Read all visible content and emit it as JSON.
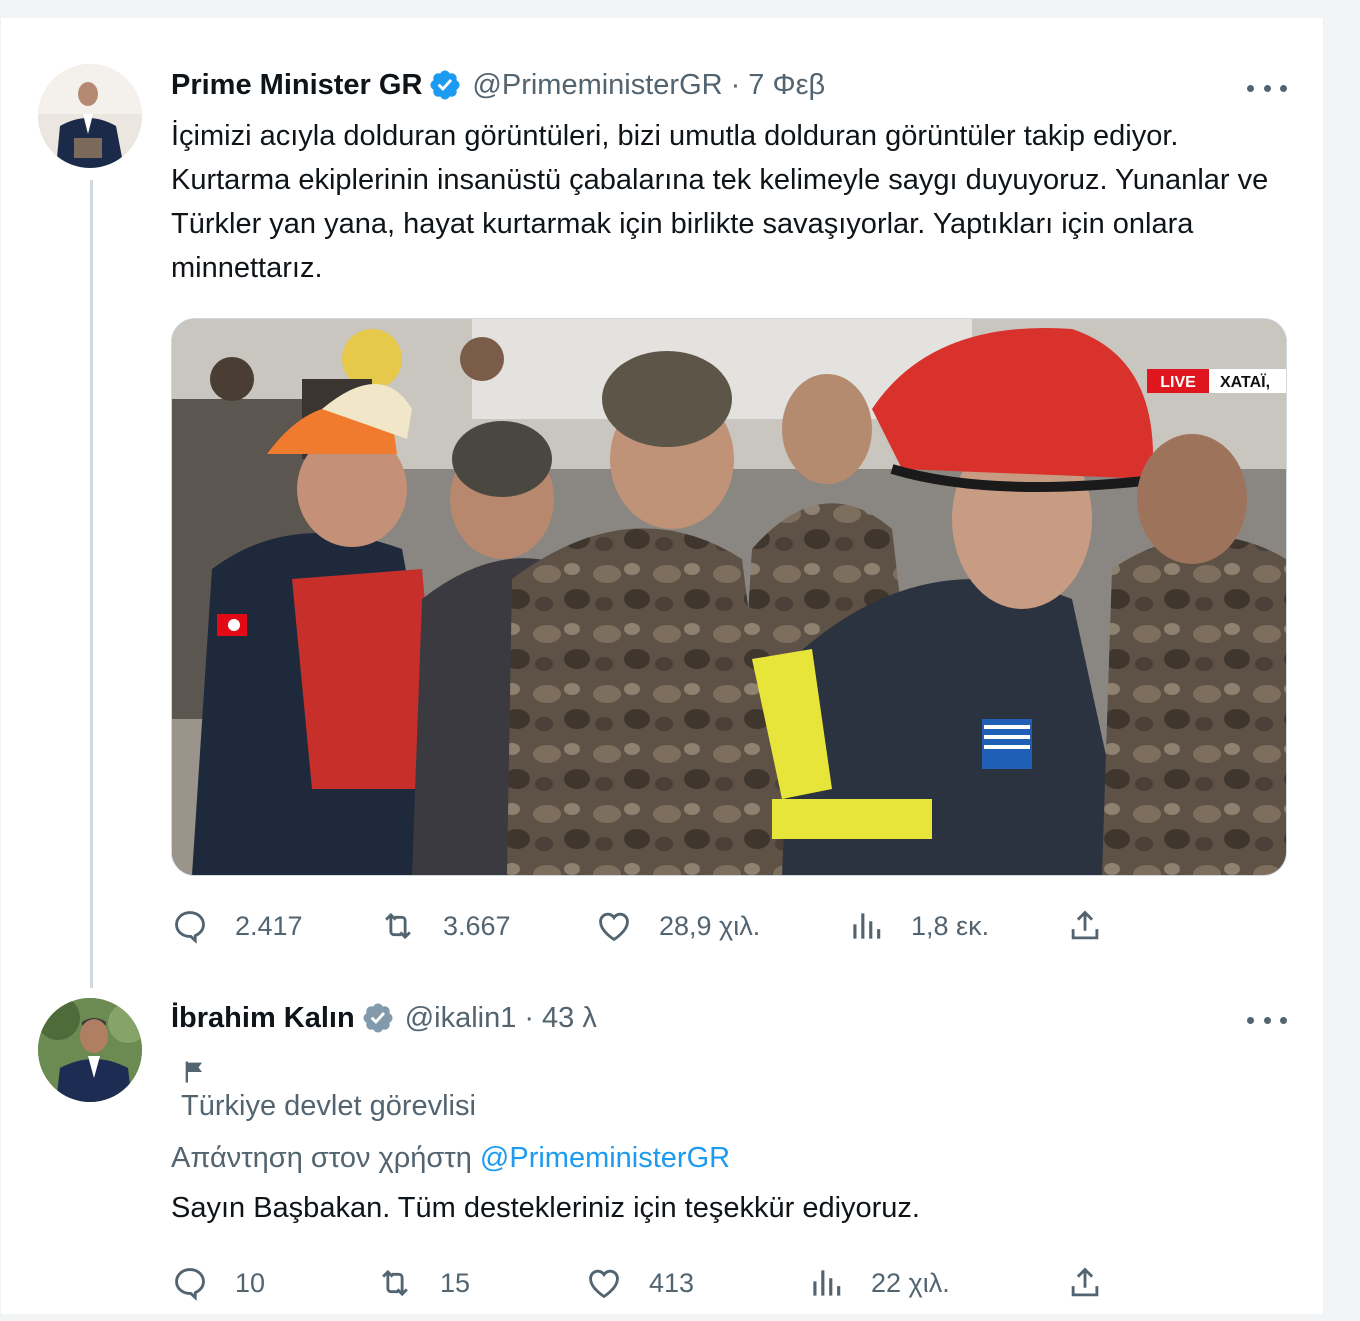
{
  "tweet1": {
    "name": "Prime Minister GR",
    "handle": "@PrimeministerGR",
    "separator": "·",
    "time": "7 Φεβ",
    "text": "İçimizi acıyla dolduran görüntüleri, bizi umutla dolduran görüntüler takip ediyor.  Kurtarma ekiplerinin insanüstü çabalarına tek kelimeyle saygı duyuyoruz. Yunanlar ve Türkler yan yana, hayat kurtarmak için birlikte savaşıyorlar. Yaptıkları için onlara minnettarız.",
    "media": {
      "live_label": "LIVE",
      "location_label": "XATAΪ,"
    },
    "actions": {
      "replies": "2.417",
      "reposts": "3.667",
      "likes": "28,9 χιλ.",
      "views": "1,8 εκ."
    }
  },
  "tweet2": {
    "name": "İbrahim Kalın",
    "handle": "@ikalin1",
    "separator": "·",
    "time": "43 λ",
    "affiliation_icon": "flag-icon",
    "affiliation_label": "Türkiye devlet görevlisi",
    "replying_prefix": "Απάντηση στον χρήστη",
    "replying_to": "@PrimeministerGR",
    "text": "Sayın Başbakan. Tüm destekleriniz için teşekkür ediyoruz.",
    "actions": {
      "replies": "10",
      "reposts": "15",
      "likes": "413",
      "views": "22 χιλ."
    }
  },
  "colors": {
    "accent": "#1d9bf0",
    "secondary_text": "#536471",
    "verified_blue": "#1d9bf0",
    "verified_gray": "#829aab"
  }
}
